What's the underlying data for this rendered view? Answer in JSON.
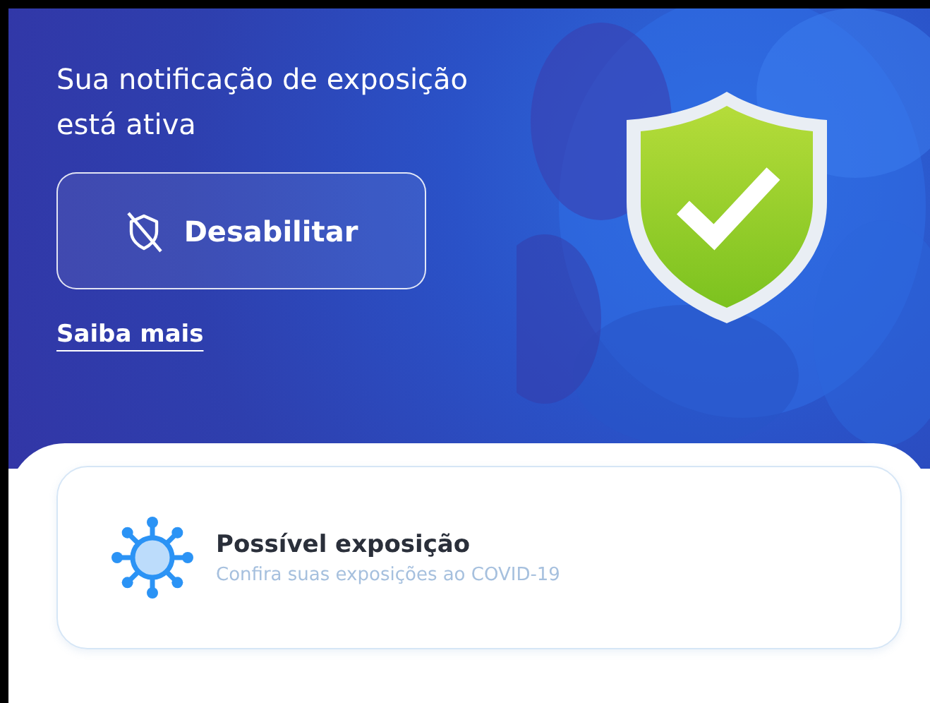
{
  "status": {
    "title": "Sua notificação de exposição está ativa",
    "button": "Desabilitar",
    "link": "Saiba mais"
  },
  "cards": [
    {
      "title": "Possível exposição",
      "subtitle": "Confira suas exposições ao COVID-19"
    }
  ]
}
